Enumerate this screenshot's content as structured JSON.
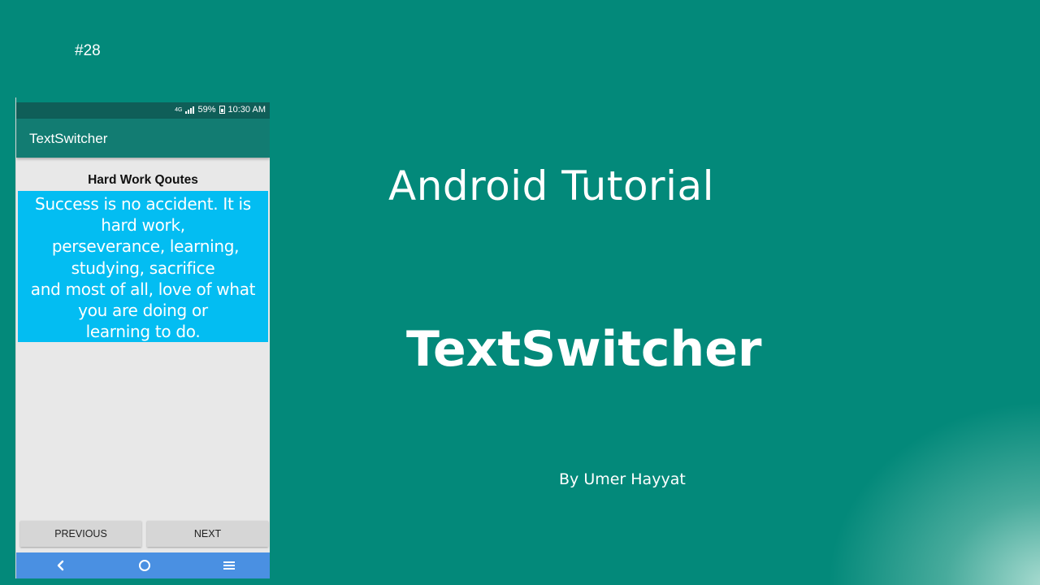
{
  "episode": "#28",
  "phone": {
    "status": {
      "network": "4G",
      "battery": "59%",
      "time": "10:30 AM"
    },
    "app_title": "TextSwitcher",
    "quote_heading": "Hard Work Qoutes",
    "quote_lines": [
      "Success is no accident. It is",
      "hard work,",
      " perseverance, learning,",
      "studying, sacrifice",
      "and most of all, love of what",
      "you are doing or",
      "learning to do."
    ],
    "buttons": {
      "previous": "PREVIOUS",
      "next": "NEXT"
    },
    "nav_icons": [
      "back-icon",
      "home-icon",
      "menu-icon"
    ]
  },
  "slide": {
    "subtitle": "Android Tutorial",
    "title": "TextSwitcher",
    "byline": "By Umer Hayyat"
  },
  "colors": {
    "background": "#03897a",
    "action_bar": "#127c72",
    "quote_box": "#03bdf2",
    "nav_bar": "#4a90e2"
  }
}
